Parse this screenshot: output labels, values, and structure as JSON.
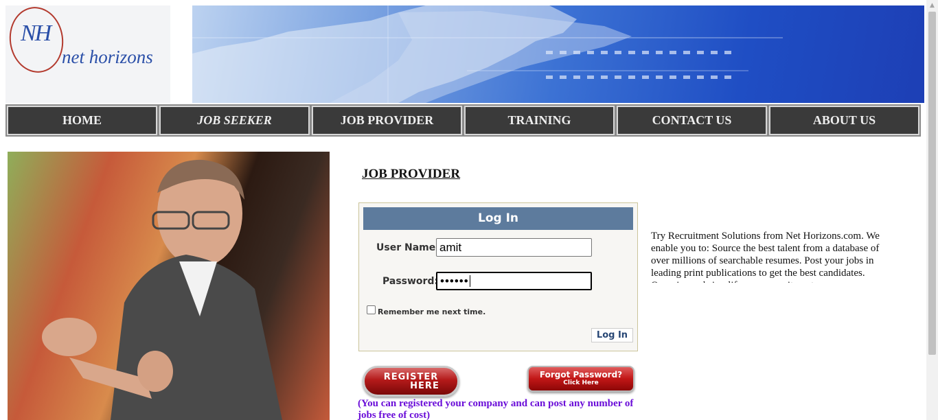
{
  "header": {
    "logo_monogram": "NH",
    "logo_text": "net horizons"
  },
  "nav": {
    "items": [
      {
        "label": "HOME"
      },
      {
        "label": "JOB SEEKER"
      },
      {
        "label": "JOB PROVIDER"
      },
      {
        "label": "TRAINING"
      },
      {
        "label": "CONTACT US"
      },
      {
        "label": "ABOUT US"
      }
    ]
  },
  "main": {
    "heading": "JOB PROVIDER",
    "login": {
      "title": "Log In",
      "username_label": "User Name:",
      "username_value": "amit",
      "password_label": "Password:",
      "password_value": "••••••",
      "remember_label": "Remember me next time.",
      "remember_checked": false,
      "submit_label": "Log In"
    },
    "register_button": {
      "line1": "REGISTER",
      "line2": "HERE"
    },
    "forgot_button": {
      "line1": "Forgot Password?",
      "line2": "Click Here"
    },
    "note": "(You can registered your company and can post any number of jobs free of cost)",
    "description": "Try Recruitment Solutions from Net Horizons.com. We enable you to: Source the best talent from a database of over millions of searchable resumes. Post your jobs in leading print publications to get the best candidates. Organise and simplify your recruitment process."
  },
  "colors": {
    "nav_bg": "#3a3a3a",
    "login_header": "#5d7b9d",
    "note_text": "#6a0dd8",
    "button_red": "#b41a1a"
  }
}
